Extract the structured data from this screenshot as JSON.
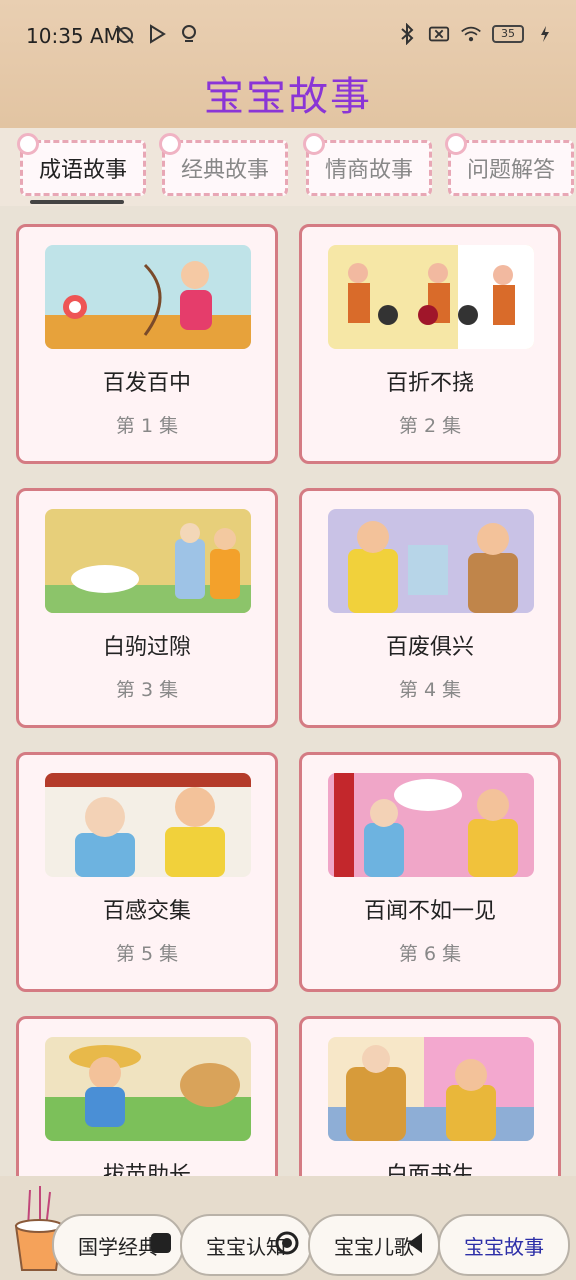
{
  "status": {
    "time": "10:35 AM",
    "left_icons": [
      "alarm-off-icon",
      "play-store-icon",
      "notification-icon"
    ],
    "right_icons": [
      "bluetooth-icon",
      "no-sim-icon",
      "wifi-icon"
    ],
    "battery": "35"
  },
  "header": {
    "title": "宝宝故事",
    "title_color": "#8a35d6"
  },
  "tabs": [
    {
      "label": "成语故事",
      "active": true
    },
    {
      "label": "经典故事",
      "active": false
    },
    {
      "label": "情商故事",
      "active": false
    },
    {
      "label": "问题解答",
      "active": false
    }
  ],
  "cards": [
    {
      "title": "百发百中",
      "episode": "第 1 集",
      "thumb_icon": "archer-cartoon-image"
    },
    {
      "title": "百折不挠",
      "episode": "第 2 集",
      "thumb_icon": "three-men-cartoon-image"
    },
    {
      "title": "白驹过隙",
      "episode": "第 3 集",
      "thumb_icon": "white-horse-cartoon-image"
    },
    {
      "title": "百废俱兴",
      "episode": "第 4 集",
      "thumb_icon": "officials-reading-cartoon-image"
    },
    {
      "title": "百感交集",
      "episode": "第 5 集",
      "thumb_icon": "two-men-cartoon-image"
    },
    {
      "title": "百闻不如一见",
      "episode": "第 6 集",
      "thumb_icon": "emperor-cartoon-image"
    },
    {
      "title": "拔苗助长",
      "episode": "",
      "thumb_icon": "farmer-cartoon-image"
    },
    {
      "title": "白面书生",
      "episode": "",
      "thumb_icon": "scholar-cartoon-image"
    }
  ],
  "bottom_nav": [
    {
      "label": "国学经典",
      "active": false
    },
    {
      "label": "宝宝认知",
      "active": false
    },
    {
      "label": "宝宝儿歌",
      "active": false
    },
    {
      "label": "宝宝故事",
      "active": true
    }
  ],
  "colors": {
    "accent": "#8a35d6",
    "card_border": "#d47b83",
    "active_nav": "#2d2fa8"
  }
}
